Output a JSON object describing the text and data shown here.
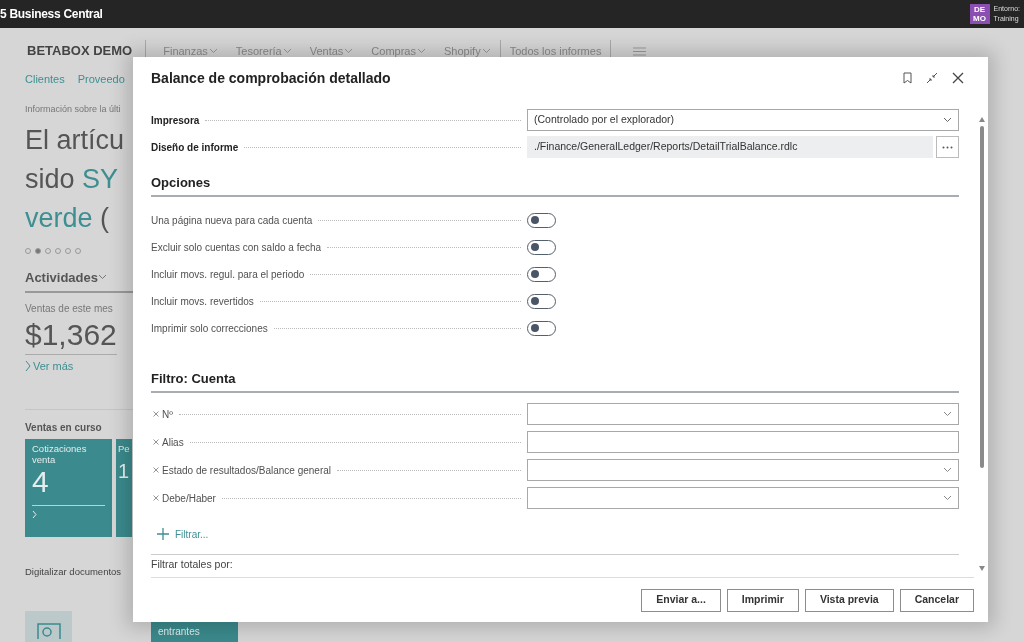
{
  "app_bar": {
    "title": "5 Business Central",
    "badge_lines": [
      "DE",
      "MO"
    ],
    "environment_label": "Entorno:",
    "environment_value": "Training"
  },
  "home": {
    "company": "BETABOX DEMO",
    "nav": [
      {
        "label": "Finanzas",
        "dropdown": true
      },
      {
        "label": "Tesorería",
        "dropdown": true
      },
      {
        "label": "Ventas",
        "dropdown": true
      },
      {
        "label": "Compras",
        "dropdown": true
      },
      {
        "label": "Shopify",
        "dropdown": true
      },
      {
        "label": "Todos los informes",
        "dropdown": false
      }
    ],
    "links": [
      "Clientes",
      "Proveedo"
    ],
    "headline_caption": "Información sobre la últi",
    "headline_lines": [
      [
        {
          "text": "El artícu",
          "accent": false
        }
      ],
      [
        {
          "text": "sido",
          "accent": false
        },
        {
          "text": "SY",
          "accent": true
        }
      ],
      [
        {
          "text": "verde",
          "accent": true
        },
        {
          "text": "(",
          "accent": false
        }
      ]
    ],
    "carousel": [
      {
        "selected": false
      },
      {
        "selected": true
      },
      {
        "selected": false
      },
      {
        "selected": false
      },
      {
        "selected": false
      },
      {
        "selected": false
      }
    ],
    "activities_title": "Actividades",
    "sales_caption": "Ventas de este mes",
    "sales_value": "$1,362",
    "see_more": "Ver más",
    "ongoing_title": "Ventas en curso",
    "tiles": [
      {
        "title": "Cotizaciones venta",
        "count": "4"
      },
      {
        "title": "Pe",
        "count": "1"
      }
    ],
    "scan_title": "Digitalizar documentos",
    "incoming_tile": "entrantes"
  },
  "dialog": {
    "title": "Balance de comprobación detallado",
    "fields": [
      {
        "kind": "select",
        "label": "Impresora",
        "value": "(Controlado por el explorador)"
      },
      {
        "kind": "readonly",
        "label": "Diseño de informe",
        "value": "./Finance/GeneralLedger/Reports/DetailTrialBalance.rdlc"
      }
    ],
    "options_title": "Opciones",
    "options": [
      {
        "label": "Una página nueva para cada cuenta",
        "on": false
      },
      {
        "label": "Excluir solo cuentas con saldo a fecha",
        "on": false
      },
      {
        "label": "Incluir movs. regul. para el periodo",
        "on": false
      },
      {
        "label": "Incluir movs. revertidos",
        "on": false
      },
      {
        "label": "Imprimir solo correcciones",
        "on": false
      }
    ],
    "filter_title": "Filtro: Cuenta",
    "filters": [
      {
        "label": "Nº",
        "kind": "select"
      },
      {
        "label": "Alias",
        "kind": "text"
      },
      {
        "label": "Estado de resultados/Balance general",
        "kind": "select"
      },
      {
        "label": "Debe/Haber",
        "kind": "select"
      }
    ],
    "add_filter": "Filtrar...",
    "next_section": "Filtrar totales por:",
    "buttons": [
      "Enviar a...",
      "Imprimir",
      "Vista previa",
      "Cancelar"
    ]
  }
}
